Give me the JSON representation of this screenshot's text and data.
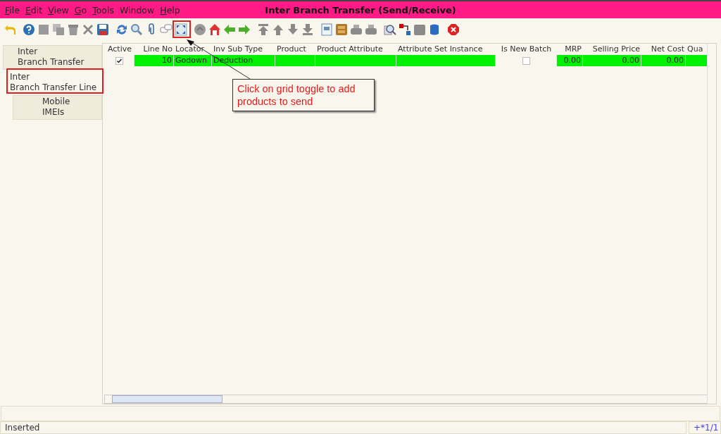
{
  "window": {
    "title": "Inter Branch Transfer (Send/Receive)"
  },
  "menu": [
    {
      "label": "File",
      "underlined": true
    },
    {
      "label": "Edit",
      "underlined": true
    },
    {
      "label": "View",
      "underlined": true
    },
    {
      "label": "Go",
      "underlined": true
    },
    {
      "label": "Tools",
      "underlined": true
    },
    {
      "label": "Window",
      "underlined": false
    },
    {
      "label": "Help",
      "underlined": true
    }
  ],
  "tabs": [
    {
      "label": "Inter\nBranch Transfer",
      "selected": false,
      "children": [
        {
          "label": "Inter\nBranch Transfer Line",
          "selected": true,
          "children": [
            {
              "label": "Mobile\nIMEIs",
              "selected": false
            }
          ]
        }
      ]
    }
  ],
  "table": {
    "columns": [
      {
        "label": "Active"
      },
      {
        "label": "Line No"
      },
      {
        "label": "Locator"
      },
      {
        "label": "Inv Sub Type"
      },
      {
        "label": "Product"
      },
      {
        "label": "Product Attribute"
      },
      {
        "label": "Attribute Set Instance"
      },
      {
        "label": "Is New Batch"
      },
      {
        "label": "MRP"
      },
      {
        "label": "Selling Price"
      },
      {
        "label": "Net Cost"
      },
      {
        "label": "Qua"
      }
    ],
    "rows": [
      {
        "cells": [
          {
            "kind": "check",
            "checked": true
          },
          {
            "kind": "text",
            "text": "10"
          },
          {
            "kind": "text",
            "text": "Godown"
          },
          {
            "kind": "text",
            "text": "Deduction"
          },
          {
            "kind": "empty"
          },
          {
            "kind": "empty"
          },
          {
            "kind": "empty"
          },
          {
            "kind": "check",
            "checked": false
          },
          {
            "kind": "text",
            "text": "0.00"
          },
          {
            "kind": "text",
            "text": "0.00"
          },
          {
            "kind": "text",
            "text": "0.00"
          },
          {
            "kind": "empty"
          }
        ]
      }
    ]
  },
  "callout": {
    "text": "Click on grid toggle to add products to send"
  },
  "status_bar": {
    "message": "Inserted",
    "record": "+*1/1"
  }
}
